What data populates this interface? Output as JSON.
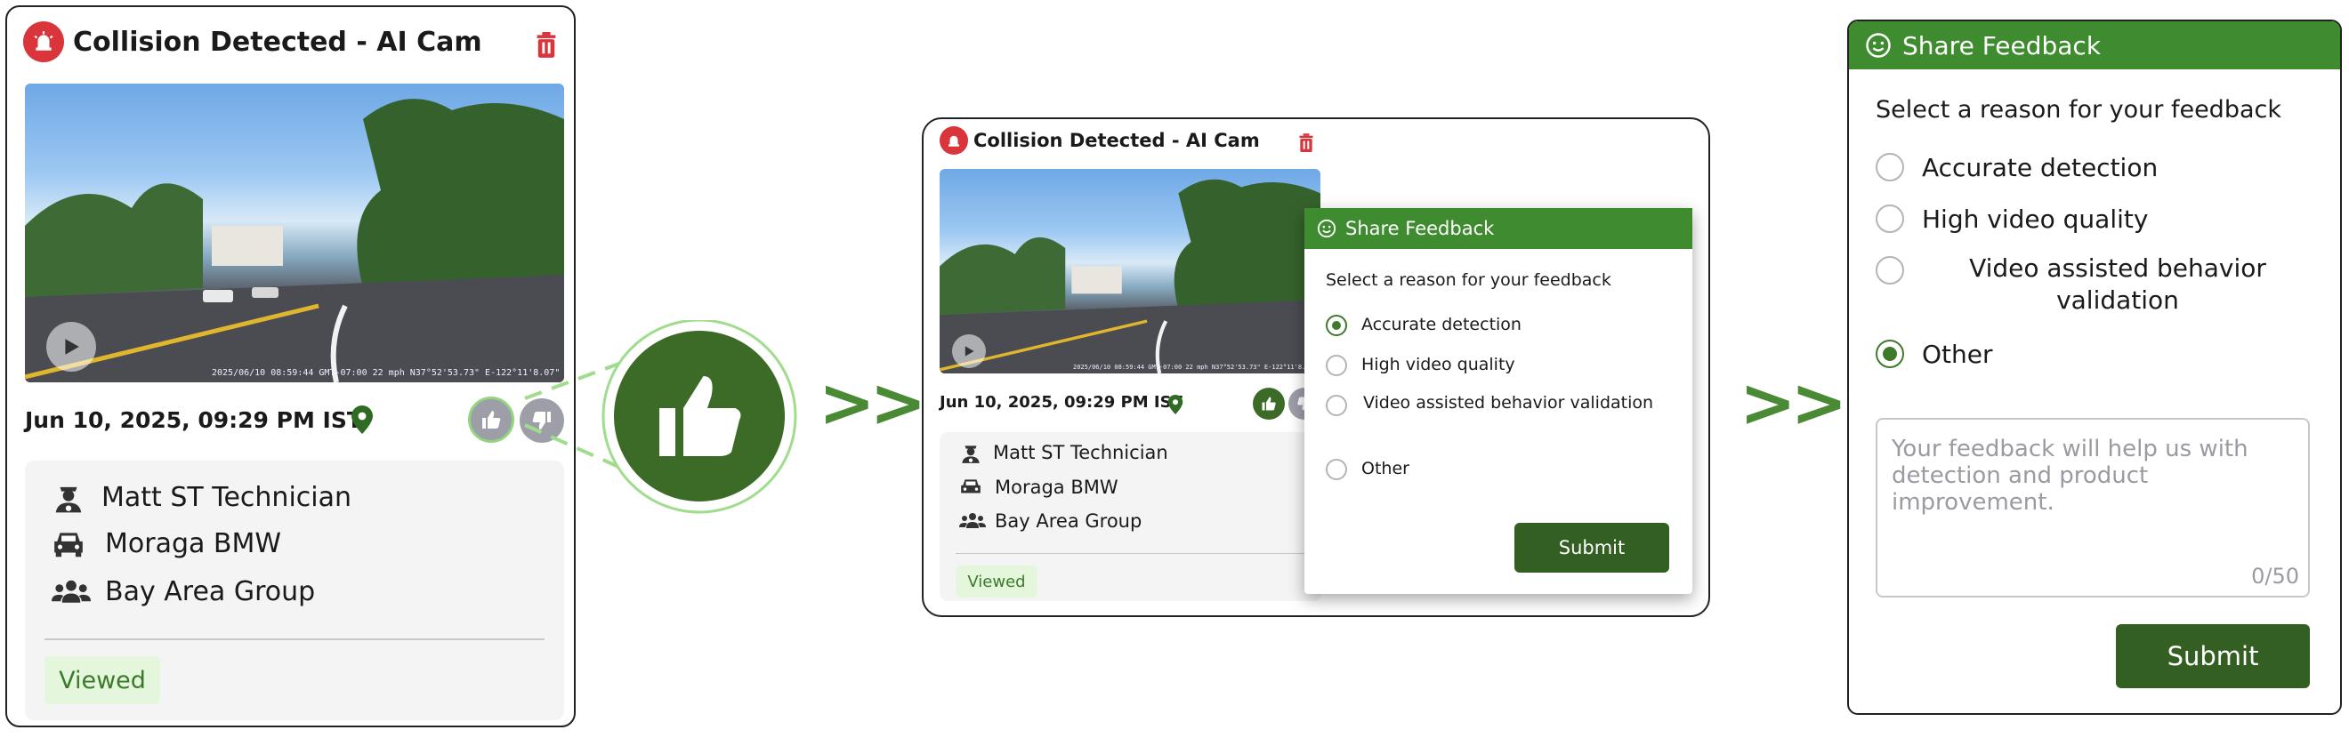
{
  "card": {
    "title": "Collision Detected - AI Cam",
    "video_stamp": "2025/06/10 08:59:44 GMT-07:00  22 mph  N37°52'53.73\" E-122°11'8.07\"",
    "date": "Jun 10, 2025, 09:29 PM IST",
    "driver": "Matt ST Technician",
    "vehicle": "Moraga BMW",
    "group": "Bay Area Group",
    "status": "Viewed"
  },
  "feedback": {
    "title": "Share Feedback",
    "prompt": "Select a reason for your feedback",
    "options": [
      {
        "label": "Accurate detection"
      },
      {
        "label": "High video quality"
      },
      {
        "label": "Video assisted behavior validation"
      },
      {
        "label": "Other"
      }
    ],
    "middle_selected": "Accurate detection",
    "right_selected": "Other",
    "textarea_placeholder": "Your feedback will help us with detection and product improvement.",
    "char_count": "0/50",
    "submit_label": "Submit"
  },
  "arrows": ">>",
  "colors": {
    "brand_green": "#3f8c30",
    "dark_green": "#345f22",
    "alert_red": "#d9353a",
    "viewed_bg": "#e4f6dc"
  },
  "icons": [
    "alarm-icon",
    "trash-icon",
    "play-icon",
    "location-pin-icon",
    "thumbs-up-icon",
    "thumbs-down-icon",
    "driver-icon",
    "car-icon",
    "group-icon",
    "smiley-icon"
  ]
}
